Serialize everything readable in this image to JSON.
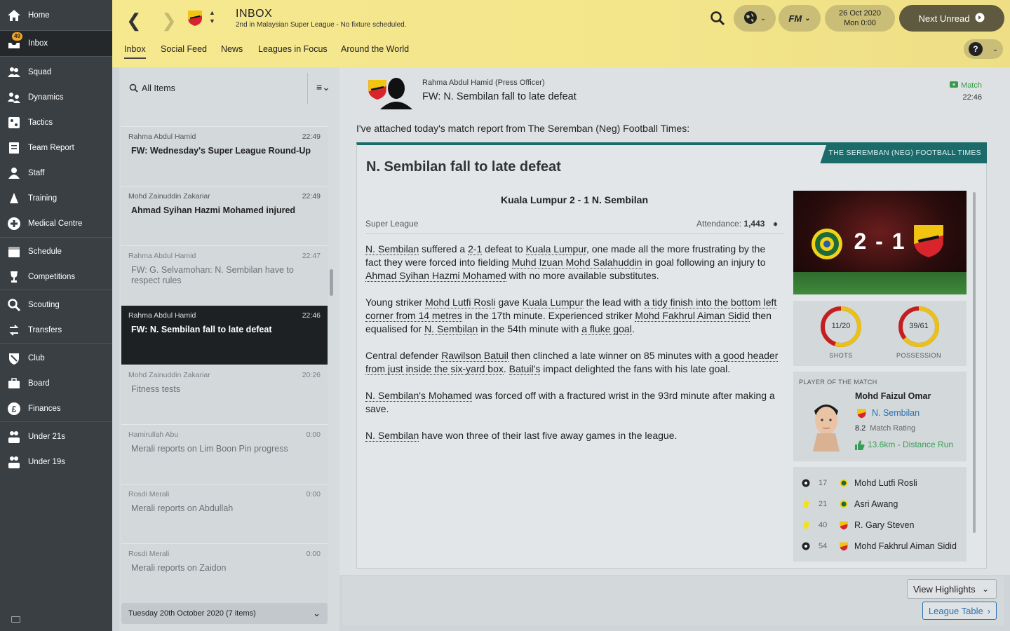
{
  "sidebar": {
    "items": [
      {
        "label": "Home",
        "icon": "home-icon"
      },
      {
        "label": "Inbox",
        "icon": "inbox-icon",
        "badge": "49"
      },
      {
        "label": "Squad",
        "icon": "squad-icon"
      },
      {
        "label": "Dynamics",
        "icon": "dynamics-icon"
      },
      {
        "label": "Tactics",
        "icon": "tactics-icon"
      },
      {
        "label": "Team Report",
        "icon": "team-report-icon"
      },
      {
        "label": "Staff",
        "icon": "staff-icon"
      },
      {
        "label": "Training",
        "icon": "training-icon"
      },
      {
        "label": "Medical Centre",
        "icon": "medical-icon"
      },
      {
        "label": "Schedule",
        "icon": "schedule-icon"
      },
      {
        "label": "Competitions",
        "icon": "trophy-icon"
      },
      {
        "label": "Scouting",
        "icon": "search-icon"
      },
      {
        "label": "Transfers",
        "icon": "transfers-icon"
      },
      {
        "label": "Club",
        "icon": "club-icon"
      },
      {
        "label": "Board",
        "icon": "board-icon"
      },
      {
        "label": "Finances",
        "icon": "finances-icon"
      },
      {
        "label": "Under 21s",
        "icon": "under21-icon"
      },
      {
        "label": "Under 19s",
        "icon": "under19-icon"
      }
    ]
  },
  "header": {
    "title": "INBOX",
    "subtitle": "2nd in Malaysian Super League - No fixture scheduled.",
    "date": "26 Oct 2020",
    "time": "Mon 0:00",
    "next_unread": "Next Unread",
    "fm_label": "FM",
    "tabs": [
      "Inbox",
      "Social Feed",
      "News",
      "Leagues in Focus",
      "Around the World"
    ],
    "help": "?"
  },
  "list": {
    "filter": "All Items",
    "messages": [
      {
        "sender": "Rahma Abdul Hamid",
        "time": "22:49",
        "subject": "FW: Wednesday's Super League Round-Up",
        "state": "unread"
      },
      {
        "sender": "Mohd Zainuddin Zakariar",
        "time": "22:49",
        "subject": "Ahmad Syihan Hazmi Mohamed injured",
        "state": "unread"
      },
      {
        "sender": "Rahma Abdul Hamid",
        "time": "22:47",
        "subject": "FW: G. Selvamohan: N. Sembilan have to respect rules",
        "state": "read"
      },
      {
        "sender": "Rahma Abdul Hamid",
        "time": "22:46",
        "subject": "FW: N. Sembilan fall to late defeat",
        "state": "selected"
      },
      {
        "sender": "Mohd Zainuddin Zakariar",
        "time": "20:26",
        "subject": "Fitness tests",
        "state": "read"
      },
      {
        "sender": "Hamirullah Abu",
        "time": "0:00",
        "subject": "Merali reports on Lim Boon Pin progress",
        "state": "read"
      },
      {
        "sender": "Rosdi Merali",
        "time": "0:00",
        "subject": "Merali reports on Abdullah",
        "state": "read"
      },
      {
        "sender": "Rosdi Merali",
        "time": "0:00",
        "subject": "Merali reports on Zaidon",
        "state": "read"
      }
    ],
    "day_group": "Tuesday 20th October 2020 (7 items)"
  },
  "detail": {
    "sender": "Rahma Abdul Hamid (Press Officer)",
    "subject": "FW: N. Sembilan fall to late defeat",
    "tag": "Match",
    "time": "22:46",
    "intro": "I've attached today's match report from The Seremban (Neg) Football Times:",
    "report": {
      "paper": "THE SEREMBAN (NEG) FOOTBALL TIMES",
      "headline": "N. Sembilan fall to late defeat",
      "score_line": "Kuala Lumpur 2 - 1 N. Sembilan",
      "competition": "Super League",
      "attendance_label": "Attendance:",
      "attendance": "1,443",
      "paragraphs": [
        "N. Sembilan suffered a 2-1 defeat to Kuala Lumpur, one made all the more frustrating by the fact they were forced into fielding Muhd Izuan Mohd Salahuddin in goal following an injury to Ahmad Syihan Hazmi Mohamed with no more available substitutes.",
        "Young striker Mohd Lutfi Rosli gave Kuala Lumpur the lead with a tidy finish into the bottom left corner from 14 metres in the 17th minute. Experienced striker Mohd Fakhrul Aiman Sidid then equalised for N. Sembilan in the 54th minute with a fluke goal.",
        "Central defender Rawilson Batuil then clinched a late winner on 85 minutes with a good header from just inside the six-yard box. Batuil's impact delighted the fans with his late goal.",
        "N. Sembilan's Mohamed was forced off with a fractured wrist in the 93rd minute after making a save.",
        "N. Sembilan have won three of their last five away games in the league."
      ],
      "score_display": "2 - 1",
      "stats": [
        {
          "name": "SHOTS",
          "home": 11,
          "total": 20,
          "label": "11/20"
        },
        {
          "name": "POSSESSION",
          "home": 39,
          "total": 61,
          "label": "39/61"
        }
      ],
      "potm": {
        "title": "PLAYER OF THE MATCH",
        "name": "Mohd Faizul Omar",
        "club": "N. Sembilan",
        "rating": "8.2",
        "rating_label": "Match Rating",
        "distance": "13.6km - Distance Run"
      },
      "events": [
        {
          "type": "goal",
          "minute": "17",
          "team": "kl",
          "player": "Mohd Lutfi Rosli"
        },
        {
          "type": "yellow",
          "minute": "21",
          "team": "kl",
          "player": "Asri Awang"
        },
        {
          "type": "yellow",
          "minute": "40",
          "team": "ns",
          "player": "R. Gary Steven"
        },
        {
          "type": "goal",
          "minute": "54",
          "team": "ns",
          "player": "Mohd Fakhrul Aiman Sidid"
        }
      ]
    }
  },
  "bottom": {
    "view_highlights": "View Highlights",
    "league_table": "League Table"
  },
  "colors": {
    "header_yellow": "#f3e58a",
    "sidebar": "#3a3f43",
    "report_accent": "#1c6b6b",
    "link_blue": "#2a6fb0",
    "ring_home": "#e8c21a",
    "ring_away": "#c41e1e"
  }
}
